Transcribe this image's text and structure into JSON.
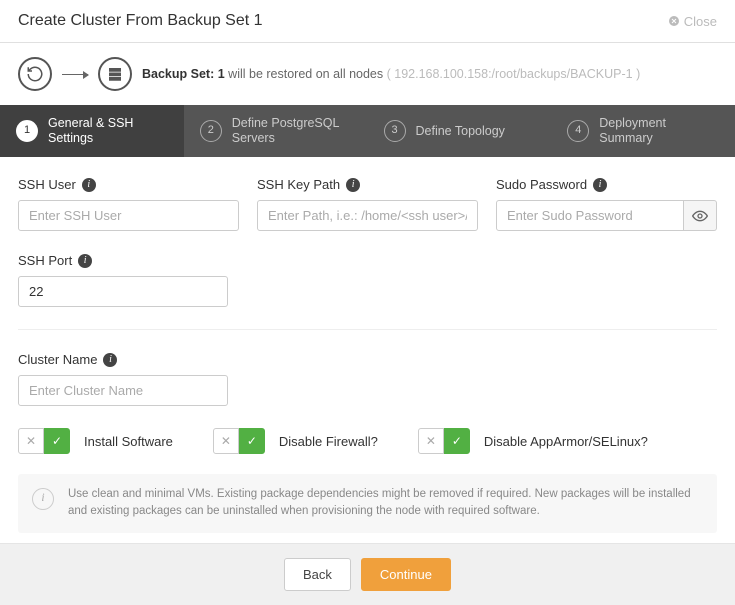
{
  "header": {
    "title": "Create Cluster From Backup Set 1",
    "close": "Close"
  },
  "backup": {
    "prefix": "Backup Set:",
    "set": "1",
    "suffix": "will be restored on all nodes",
    "path": "( 192.168.100.158:/root/backups/BACKUP-1 )"
  },
  "steps": [
    {
      "num": "1",
      "label": "General & SSH Settings"
    },
    {
      "num": "2",
      "label": "Define PostgreSQL Servers"
    },
    {
      "num": "3",
      "label": "Define Topology"
    },
    {
      "num": "4",
      "label": "Deployment Summary"
    }
  ],
  "fields": {
    "ssh_user": {
      "label": "SSH User",
      "placeholder": "Enter SSH User",
      "value": ""
    },
    "ssh_key": {
      "label": "SSH Key Path",
      "placeholder": "Enter Path, i.e.: /home/<ssh user>/.s",
      "value": ""
    },
    "sudo_pw": {
      "label": "Sudo Password",
      "placeholder": "Enter Sudo Password",
      "value": ""
    },
    "ssh_port": {
      "label": "SSH Port",
      "placeholder": "",
      "value": "22"
    },
    "cluster": {
      "label": "Cluster Name",
      "placeholder": "Enter Cluster Name",
      "value": ""
    }
  },
  "toggles": {
    "install": "Install Software",
    "firewall": "Disable Firewall?",
    "apparmor": "Disable AppArmor/SELinux?"
  },
  "info_text": "Use clean and minimal VMs. Existing package dependencies might be removed if required. New packages will be installed and existing packages can be uninstalled when provisioning the node with required software.",
  "buttons": {
    "back": "Back",
    "continue": "Continue"
  }
}
